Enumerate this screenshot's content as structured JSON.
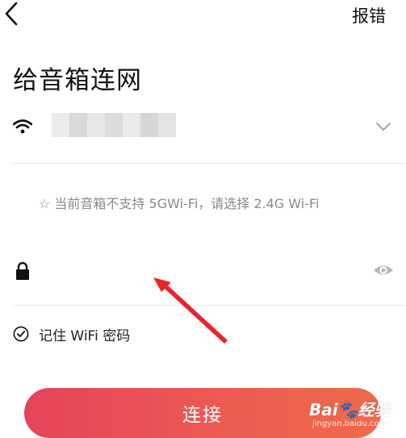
{
  "header": {
    "back_icon": "chevron-left-icon",
    "report_label": "报错"
  },
  "page": {
    "title": "给音箱连网"
  },
  "wifi": {
    "icon": "wifi-icon",
    "ssid": "",
    "dropdown_icon": "chevron-down-icon"
  },
  "notice": {
    "text": "☆ 当前音箱不支持 5GWi-Fi，请选择 2.4G Wi-Fi"
  },
  "password": {
    "icon": "lock-icon",
    "value": "",
    "placeholder": "",
    "toggle_icon": "eye-icon"
  },
  "remember": {
    "label": "记住 WiFi 密码",
    "checked": true
  },
  "connect": {
    "label": "连接"
  },
  "colors": {
    "button_start": "#e4445a",
    "button_end": "#ef6a4a",
    "annotation_arrow": "#e8262b"
  },
  "watermark": {
    "logo": "Bai🐾经验",
    "url": "jingyan.baidu.com"
  }
}
